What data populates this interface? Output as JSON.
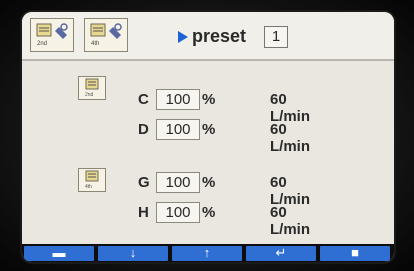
{
  "header": {
    "modes": [
      {
        "icon": "machine-2nd-icon",
        "label": "2nd"
      },
      {
        "icon": "machine-4th-icon",
        "label": "4th"
      }
    ],
    "preset_label": "preset",
    "preset_value": "1"
  },
  "sections": [
    {
      "icon": "machine-2nd-icon",
      "icon_label": "2nd",
      "rows": [
        {
          "letter": "C",
          "value": "100",
          "unit": "%",
          "flow": "60 L/min"
        },
        {
          "letter": "D",
          "value": "100",
          "unit": "%",
          "flow": "60 L/min"
        }
      ]
    },
    {
      "icon": "machine-4th-icon",
      "icon_label": "4th",
      "rows": [
        {
          "letter": "G",
          "value": "100",
          "unit": "%",
          "flow": "60 L/min"
        },
        {
          "letter": "H",
          "value": "100",
          "unit": "%",
          "flow": "60 L/min"
        }
      ]
    }
  ],
  "footer": {
    "buttons": [
      {
        "name": "menu-button",
        "icon": "menu-bar-icon",
        "glyph": "▬"
      },
      {
        "name": "down-button",
        "icon": "arrow-down-icon",
        "glyph": "↓"
      },
      {
        "name": "up-button",
        "icon": "arrow-up-icon",
        "glyph": "↑"
      },
      {
        "name": "enter-button",
        "icon": "enter-icon",
        "glyph": "↵"
      },
      {
        "name": "camera-button",
        "icon": "camera-icon",
        "glyph": "■"
      }
    ]
  },
  "colors": {
    "accent": "#2f6ed2",
    "arrow": "#1e62d6",
    "screen_bg": "#e9e7e0"
  }
}
